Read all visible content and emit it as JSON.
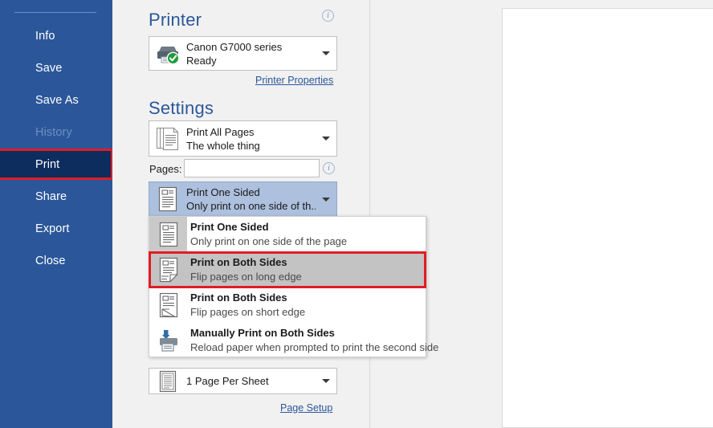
{
  "sidebar": {
    "items": [
      {
        "label": "Info",
        "state": "normal"
      },
      {
        "label": "Save",
        "state": "normal"
      },
      {
        "label": "Save As",
        "state": "normal"
      },
      {
        "label": "History",
        "state": "disabled"
      },
      {
        "label": "Print",
        "state": "active"
      },
      {
        "label": "Share",
        "state": "normal"
      },
      {
        "label": "Export",
        "state": "normal"
      },
      {
        "label": "Close",
        "state": "normal"
      }
    ],
    "accent_color": "#2b579a",
    "active_color": "#0d2d5e",
    "highlight_color": "#e01c24"
  },
  "printer": {
    "heading": "Printer",
    "info_icon": "info-icon",
    "name": "Canon G7000 series",
    "status": "Ready",
    "status_icon": "printer-ready-check-icon",
    "properties_link": "Printer Properties",
    "dropdown_icon": "chevron-down-icon"
  },
  "settings": {
    "heading": "Settings",
    "print_range": {
      "icon": "print-all-pages-icon",
      "main": "Print All Pages",
      "sub": "The whole thing",
      "dropdown_icon": "chevron-down-icon"
    },
    "pages": {
      "label": "Pages:",
      "value": "",
      "placeholder": "",
      "info_icon": "info-icon"
    },
    "sides": {
      "icon": "print-one-sided-icon",
      "main": "Print One Sided",
      "sub": "Only print on one side of th...",
      "dropdown_icon": "chevron-down-icon"
    },
    "pages_per_sheet": {
      "icon": "one-page-per-sheet-icon",
      "main": "1 Page Per Sheet",
      "dropdown_icon": "chevron-down-icon"
    },
    "page_setup_link": "Page Setup"
  },
  "dropdown": {
    "items": [
      {
        "icon": "print-one-sided-icon",
        "title": "Print One Sided",
        "desc": "Only print on one side of the page",
        "state": "current"
      },
      {
        "icon": "print-both-sides-long-edge-icon",
        "title": "Print on Both Sides",
        "desc": "Flip pages on long edge",
        "state": "hover"
      },
      {
        "icon": "print-both-sides-short-edge-icon",
        "title": "Print on Both Sides",
        "desc": "Flip pages on short edge",
        "state": "normal"
      },
      {
        "icon": "manually-print-both-sides-icon",
        "title": "Manually Print on Both Sides",
        "desc": "Reload paper when prompted to print the second side",
        "state": "normal"
      }
    ],
    "hover_background": "#c3c3c3",
    "highlight_color": "#e01c24"
  },
  "preview": {
    "page_background": "#ffffff"
  }
}
